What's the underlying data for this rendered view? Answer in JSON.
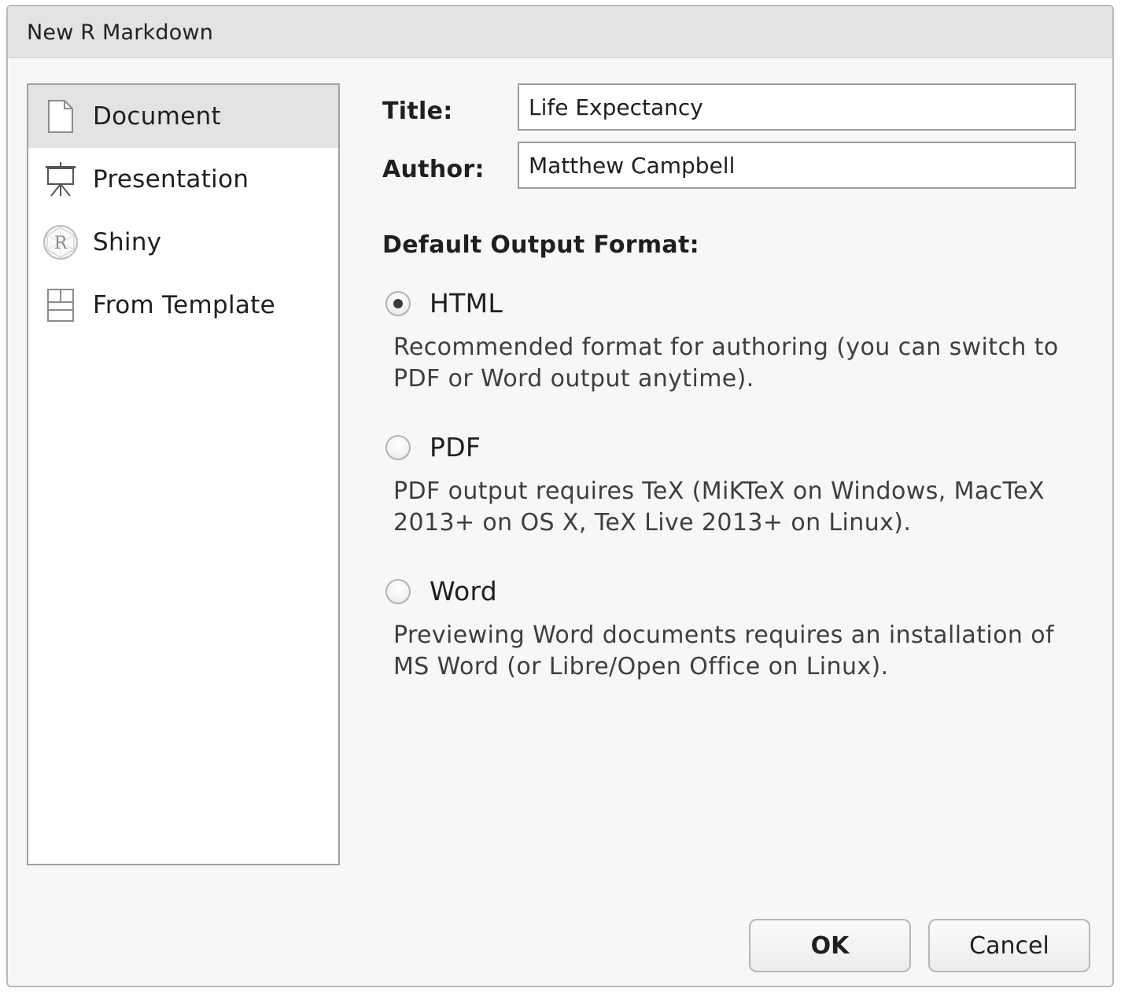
{
  "window": {
    "title": "New R Markdown"
  },
  "sidebar": {
    "items": [
      {
        "label": "Document",
        "icon": "document-icon",
        "selected": true
      },
      {
        "label": "Presentation",
        "icon": "presentation-icon",
        "selected": false
      },
      {
        "label": "Shiny",
        "icon": "shiny-r-icon",
        "selected": false
      },
      {
        "label": "From Template",
        "icon": "template-icon",
        "selected": false
      }
    ]
  },
  "form": {
    "title_label": "Title:",
    "title_value": "Life Expectancy",
    "author_label": "Author:",
    "author_value": "Matthew Campbell",
    "output_heading": "Default Output Format:"
  },
  "formats": [
    {
      "label": "HTML",
      "selected": true,
      "description": "Recommended format for authoring (you can switch to PDF or Word output anytime)."
    },
    {
      "label": "PDF",
      "selected": false,
      "description": "PDF output requires TeX (MiKTeX on Windows, MacTeX 2013+ on OS X, TeX Live 2013+ on Linux)."
    },
    {
      "label": "Word",
      "selected": false,
      "description": "Previewing Word documents requires an installation of MS Word (or Libre/Open Office on Linux)."
    }
  ],
  "buttons": {
    "ok": "OK",
    "cancel": "Cancel"
  }
}
